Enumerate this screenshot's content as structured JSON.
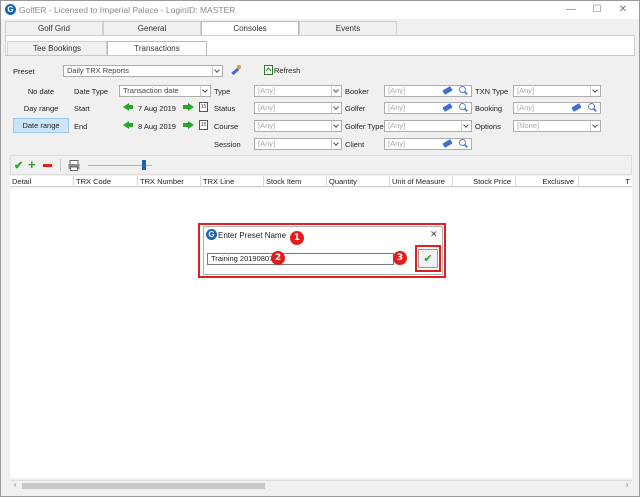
{
  "window": {
    "title": "GolfER - Licensed to Imperial Palace - LoginID: MASTER",
    "controls": {
      "minimize": "—",
      "maximize": "☐",
      "close": "✕"
    }
  },
  "main_tabs": [
    {
      "label": "Golf Grid",
      "active": false
    },
    {
      "label": "General",
      "active": false
    },
    {
      "label": "Consoles",
      "active": true
    },
    {
      "label": "Events",
      "active": false
    }
  ],
  "sub_tabs": [
    {
      "label": "Tee Bookings",
      "active": false
    },
    {
      "label": "Transactions",
      "active": true
    }
  ],
  "filters": {
    "preset_label": "Preset",
    "preset_value": "Daily TRX Reports",
    "refresh_label": "Refresh",
    "date_modes": [
      "No date",
      "Day range",
      "Date range"
    ],
    "date_type_label": "Date Type",
    "date_type_value": "Transaction date",
    "start_label": "Start",
    "start_date": "7 Aug 2019",
    "end_label": "End",
    "end_date": "8 Aug 2019",
    "type_label": "Type",
    "status_label": "Status",
    "course_label": "Course",
    "session_label": "Session",
    "booker_label": "Booker",
    "golfer_label": "Golfer",
    "golfer_type_label": "Golfer Type",
    "client_label": "Client",
    "txn_type_label": "TXN Type",
    "booking_label": "Booking",
    "options_label": "Options",
    "any": "[Any]",
    "none": "[None]"
  },
  "grid": {
    "columns": [
      "Detail",
      "TRX Code",
      "TRX Number",
      "TRX Line",
      "Stock Item",
      "Quantity",
      "Unit of Measure",
      "Stock Price",
      "Exclusive",
      "T"
    ]
  },
  "dialog": {
    "title": "Enter Preset Name",
    "input_value": "Training 20190807",
    "close": "✕",
    "confirm": "✔"
  },
  "callouts": [
    "1",
    "2",
    "3"
  ],
  "scroll": {
    "left": "‹",
    "right": "›"
  },
  "colors": {
    "accent": "#1b63b5",
    "callout": "#e01e1e",
    "green": "#2aa52a"
  }
}
